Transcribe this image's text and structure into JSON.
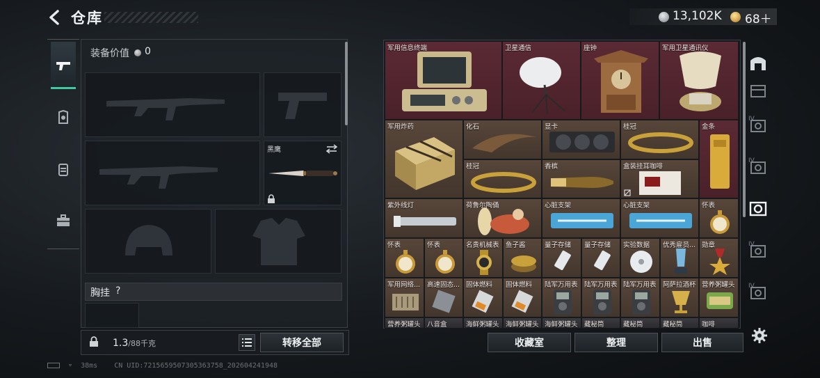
{
  "header": {
    "title": "仓库",
    "silver_amount": "13,102K",
    "gold_amount": "68＋"
  },
  "loadout": {
    "value_label": "装备价值",
    "value": "0",
    "knife_slot_label": "黑鹰",
    "chest_rig_label": "胸挂",
    "chest_rig_help": "?"
  },
  "capacity": {
    "current": "1.3",
    "max": "/88",
    "unit": "千克"
  },
  "buttons": {
    "transfer_all": "转移全部",
    "collection_room": "收藏室",
    "sort": "整理",
    "sell": "出售"
  },
  "storage": {
    "items": [
      {
        "name": "军用信息终端",
        "rarity": "red",
        "icon": "field-terminal"
      },
      {
        "name": "卫星通信",
        "rarity": "red",
        "icon": "satellite-dish"
      },
      {
        "name": "座钟",
        "rarity": "red",
        "icon": "table-clock"
      },
      {
        "name": "军用卫星通讯仪",
        "rarity": "red",
        "icon": "satellite-comm"
      },
      {
        "name": "军用炸药",
        "rarity": "gold",
        "icon": "explosive-crate"
      },
      {
        "name": "化石",
        "rarity": "gold",
        "icon": "fossil-claw"
      },
      {
        "name": "显卡",
        "rarity": "gold",
        "icon": "graphics-card"
      },
      {
        "name": "桂冠",
        "rarity": "gold",
        "icon": "laurel-crown"
      },
      {
        "name": "金条",
        "rarity": "red",
        "icon": "gold-bar"
      },
      {
        "name": "桂冠",
        "rarity": "gold",
        "icon": "laurel-crown"
      },
      {
        "name": "香槟",
        "rarity": "gold",
        "icon": "champagne"
      },
      {
        "name": "盒装挂耳咖啡",
        "rarity": "gold",
        "icon": "coffee-box"
      },
      {
        "name": "紫外线灯",
        "rarity": "gold",
        "icon": "uv-lamp"
      },
      {
        "name": "荷鲁尔陶俑",
        "rarity": "gold",
        "icon": "figurine"
      },
      {
        "name": "心脏支架",
        "rarity": "gold",
        "icon": "heart-stent"
      },
      {
        "name": "心脏支架",
        "rarity": "gold",
        "icon": "heart-stent"
      },
      {
        "name": "怀表",
        "rarity": "gold",
        "icon": "pocket-watch"
      },
      {
        "name": "怀表",
        "rarity": "gold",
        "icon": "pocket-watch"
      },
      {
        "name": "怀表",
        "rarity": "gold",
        "icon": "pocket-watch"
      },
      {
        "name": "名贵机械表",
        "rarity": "gold",
        "icon": "wristwatch"
      },
      {
        "name": "鱼子酱",
        "rarity": "gold",
        "icon": "caviar-tin"
      },
      {
        "name": "量子存储",
        "rarity": "gold",
        "icon": "usb-drive"
      },
      {
        "name": "量子存储",
        "rarity": "gold",
        "icon": "usb-drive"
      },
      {
        "name": "实验数据",
        "rarity": "gold",
        "icon": "data-disc"
      },
      {
        "name": "优秀雇员...",
        "rarity": "gold",
        "icon": "trophy"
      },
      {
        "name": "勋章",
        "rarity": "gold",
        "icon": "medal"
      },
      {
        "name": "军用网络...",
        "rarity": "gold",
        "icon": "network-module"
      },
      {
        "name": "高速固态...",
        "rarity": "gold",
        "icon": "ssd"
      },
      {
        "name": "固体燃料",
        "rarity": "gold",
        "icon": "fuel-cell"
      },
      {
        "name": "固体燃料",
        "rarity": "gold",
        "icon": "fuel-cell"
      },
      {
        "name": "陆军万用表",
        "rarity": "gold",
        "icon": "multimeter"
      },
      {
        "name": "陆军万用表",
        "rarity": "gold",
        "icon": "multimeter"
      },
      {
        "name": "陆军万用表",
        "rarity": "gold",
        "icon": "multimeter"
      },
      {
        "name": "阿萨拉酒杯",
        "rarity": "gold",
        "icon": "goblet"
      },
      {
        "name": "营养粥罐头",
        "rarity": "gold",
        "icon": "food-can"
      },
      {
        "name": "营养粥罐头",
        "rarity": "gold",
        "icon": "food-can"
      },
      {
        "name": "八音盒",
        "rarity": "gold",
        "icon": "music-box"
      },
      {
        "name": "海鲜粥罐头",
        "rarity": "gold",
        "icon": "food-can"
      },
      {
        "name": "海鲜粥罐头",
        "rarity": "gold",
        "icon": "food-can"
      },
      {
        "name": "海鲜粥罐头",
        "rarity": "gold",
        "icon": "food-can"
      },
      {
        "name": "藏秘筒",
        "rarity": "gold",
        "icon": "canister"
      },
      {
        "name": "藏秘筒",
        "rarity": "gold",
        "icon": "canister"
      },
      {
        "name": "藏秘筒",
        "rarity": "gold",
        "icon": "canister"
      },
      {
        "name": "咖啡",
        "rarity": "gold",
        "icon": "coffee"
      }
    ]
  },
  "rail_badges": [
    "IV",
    "IV",
    "IV",
    "IV"
  ],
  "status": {
    "ping": "38ms",
    "uid": "CN UID:7215659507305363758_202604241948"
  },
  "colors": {
    "accent": "#3ec9a0",
    "rarity_red": "#5b2a34",
    "rarity_gold": "#58463a"
  }
}
